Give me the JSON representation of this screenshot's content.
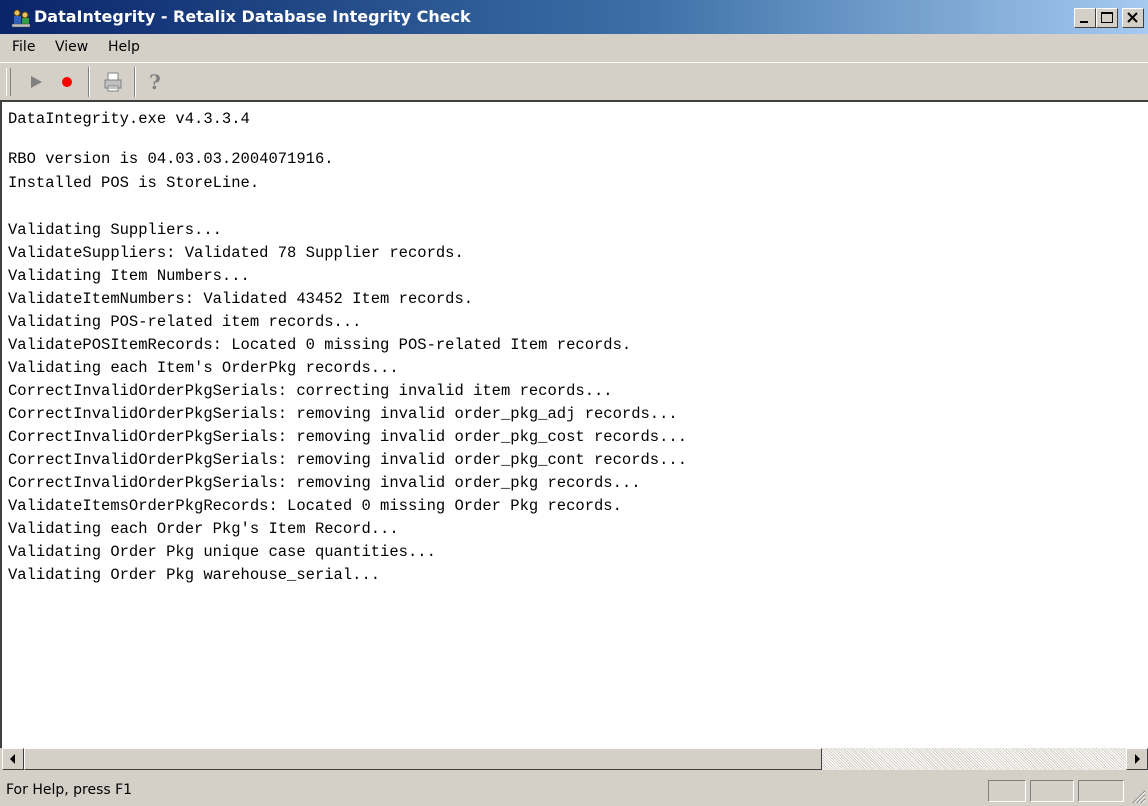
{
  "window": {
    "title": "DataIntegrity - Retalix Database Integrity Check",
    "icons": {
      "app": "app-icon",
      "minimize": "minimize-icon",
      "maximize": "maximize-icon",
      "close": "close-icon"
    }
  },
  "menu": {
    "items": [
      {
        "label": "File"
      },
      {
        "label": "View"
      },
      {
        "label": "Help"
      }
    ]
  },
  "toolbar": {
    "buttons": [
      {
        "icon": "play-icon",
        "enabled": false
      },
      {
        "icon": "record-icon",
        "enabled": true,
        "color": "#ff0000"
      },
      {
        "icon": "print-icon",
        "enabled": false
      },
      {
        "icon": "help-icon",
        "enabled": false
      }
    ]
  },
  "output": {
    "lines": [
      "DataIntegrity.exe v4.3.3.4",
      "",
      "RBO version is 04.03.03.2004071916.",
      "Installed POS is StoreLine.",
      "",
      "Validating Suppliers...",
      "ValidateSuppliers: Validated 78 Supplier records.",
      "Validating Item Numbers...",
      "ValidateItemNumbers: Validated 43452 Item records.",
      "Validating POS-related item records...",
      "ValidatePOSItemRecords: Located 0 missing POS-related Item records.",
      "Validating each Item's OrderPkg records...",
      "CorrectInvalidOrderPkgSerials: correcting invalid item records...",
      "CorrectInvalidOrderPkgSerials: removing invalid order_pkg_adj records...",
      "CorrectInvalidOrderPkgSerials: removing invalid order_pkg_cost records...",
      "CorrectInvalidOrderPkgSerials: removing invalid order_pkg_cont records...",
      "CorrectInvalidOrderPkgSerials: removing invalid order_pkg records...",
      "ValidateItemsOrderPkgRecords: Located 0 missing Order Pkg records.",
      "Validating each Order Pkg's Item Record...",
      "Validating Order Pkg unique case quantities...",
      "Validating Order Pkg warehouse_serial..."
    ]
  },
  "statusbar": {
    "text": "For Help, press F1"
  },
  "colors": {
    "titlebar_start": "#0a246a",
    "titlebar_end": "#a6caf0",
    "face": "#d4d0c8",
    "record": "#ff0000"
  }
}
